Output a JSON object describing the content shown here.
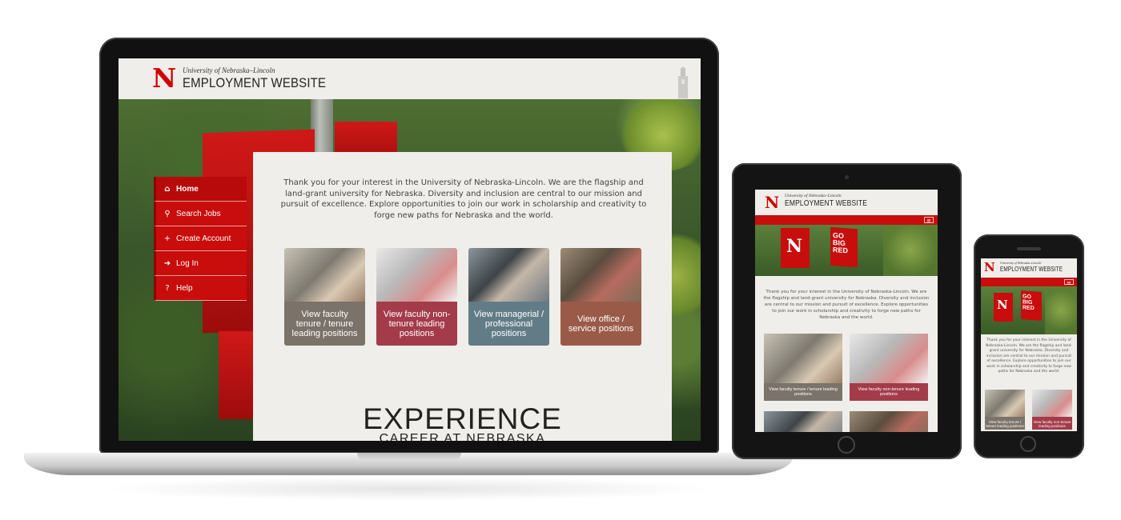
{
  "site": {
    "university": "University of Nebraska–Lincoln",
    "title": "EMPLOYMENT WEBSITE",
    "logo_letter": "N",
    "brand_color": "#d00000"
  },
  "nav": {
    "items": [
      {
        "icon": "home-icon",
        "glyph": "⌂",
        "label": "Home"
      },
      {
        "icon": "search-icon",
        "glyph": "⚲",
        "label": "Search Jobs"
      },
      {
        "icon": "plus-icon",
        "glyph": "+",
        "label": "Create Account"
      },
      {
        "icon": "login-icon",
        "glyph": "➜",
        "label": "Log In"
      },
      {
        "icon": "help-icon",
        "glyph": "?",
        "label": "Help"
      }
    ]
  },
  "intro": {
    "desktop": "Thank you for your interest in the University of Nebraska-Lincoln. We are the flagship and land-grant university for Nebraska. Diversity and inclusion are central to our mission and pursuit of excellence. Explore opportunities to join our work in scholarship and creativity to forge new paths for Nebraska and the world.",
    "tablet": "Thank you for your interest in the University of Nebraska-Lincoln. We are the flagship and land-grant university for Nebraska. Diversity and inclusion are central to our mission and pursuit of excellence. Explore opportunities to join our work in scholarship and creativity to forge new paths for Nebraska and the world.",
    "phone": "Thank you for your interest in the University of Nebraska-Lincoln. We are the flagship and land-grant university for Nebraska. Diversity and inclusion are central to our mission and pursuit of excellence. Explore opportunities to join our work in scholarship and creativity to forge new paths for Nebraska and the world."
  },
  "tiles": [
    {
      "label": "View faculty tenure / tenure leading positions",
      "color": "#7b7269"
    },
    {
      "label": "View faculty non-tenure leading positions",
      "color": "#a33b4a"
    },
    {
      "label": "View managerial / professional positions",
      "color": "#627c87"
    },
    {
      "label": "View office / service positions",
      "color": "#9a5a48"
    }
  ],
  "experience": {
    "heading": "EXPERIENCE",
    "subheading": "CAREER AT NEBRASKA"
  },
  "banner": {
    "go": "GO",
    "big": "BIG",
    "red": "RED"
  }
}
